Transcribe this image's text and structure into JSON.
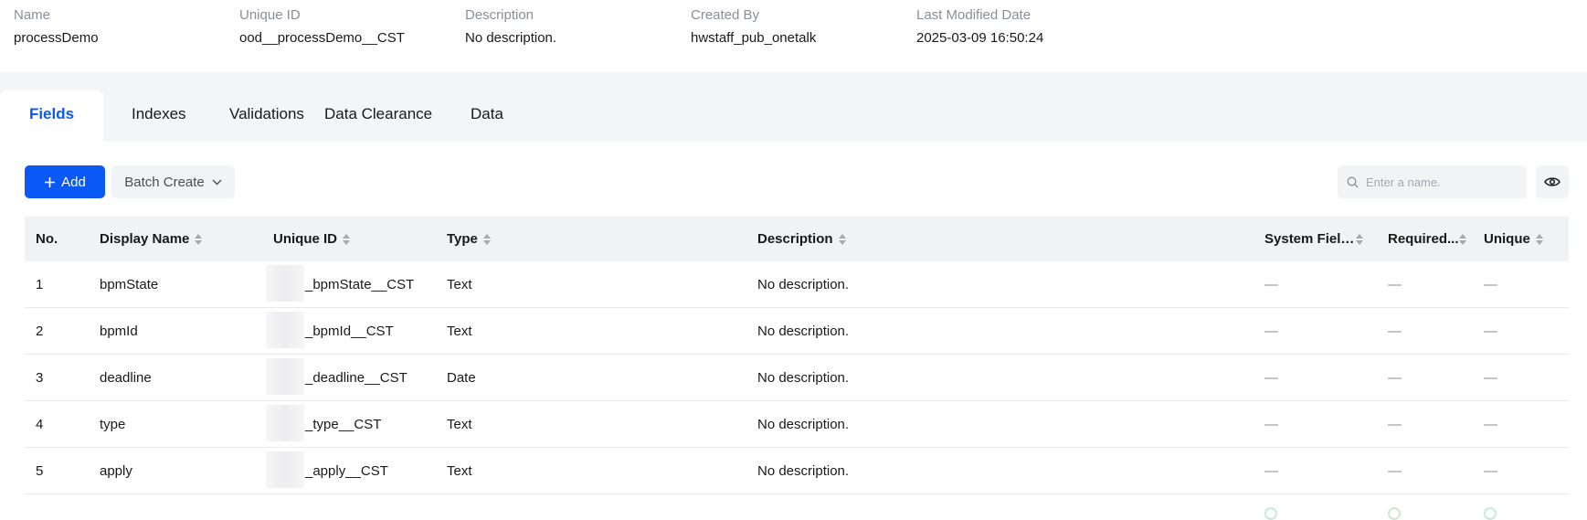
{
  "info": [
    {
      "label": "Name",
      "value": "processDemo"
    },
    {
      "label": "Unique ID",
      "value": "ood__processDemo__CST"
    },
    {
      "label": "Description",
      "value": "No description."
    },
    {
      "label": "Created By",
      "value": "hwstaff_pub_onetalk"
    },
    {
      "label": "Last Modified Date",
      "value": "2025-03-09 16:50:24"
    }
  ],
  "tabs": [
    {
      "label": "Fields",
      "active": true
    },
    {
      "label": "Indexes"
    },
    {
      "label": "Validations"
    },
    {
      "label": "Data Clearance"
    },
    {
      "label": "Data"
    }
  ],
  "toolbar": {
    "add_label": "Add",
    "batch_label": "Batch Create",
    "search_placeholder": "Enter a name.",
    "accent_color": "#0a59f7"
  },
  "table": {
    "columns": [
      "No.",
      "Display Name",
      "Unique ID",
      "Type",
      "Description",
      "System Field...",
      "Required...",
      "Unique"
    ],
    "rows": [
      {
        "no": "1",
        "display_name": "bpmState",
        "unique_id": "_bpmState__CST",
        "type": "Text",
        "description": "No description.",
        "system_field": "—",
        "required": "—",
        "unique": "—"
      },
      {
        "no": "2",
        "display_name": "bpmId",
        "unique_id": "_bpmId__CST",
        "type": "Text",
        "description": "No description.",
        "system_field": "—",
        "required": "—",
        "unique": "—"
      },
      {
        "no": "3",
        "display_name": "deadline",
        "unique_id": "_deadline__CST",
        "type": "Date",
        "description": "No description.",
        "system_field": "—",
        "required": "—",
        "unique": "—"
      },
      {
        "no": "4",
        "display_name": "type",
        "unique_id": "_type__CST",
        "type": "Text",
        "description": "No description.",
        "system_field": "—",
        "required": "—",
        "unique": "—"
      },
      {
        "no": "5",
        "display_name": "apply",
        "unique_id": "_apply__CST",
        "type": "Text",
        "description": "No description.",
        "system_field": "—",
        "required": "—",
        "unique": "—"
      }
    ]
  }
}
